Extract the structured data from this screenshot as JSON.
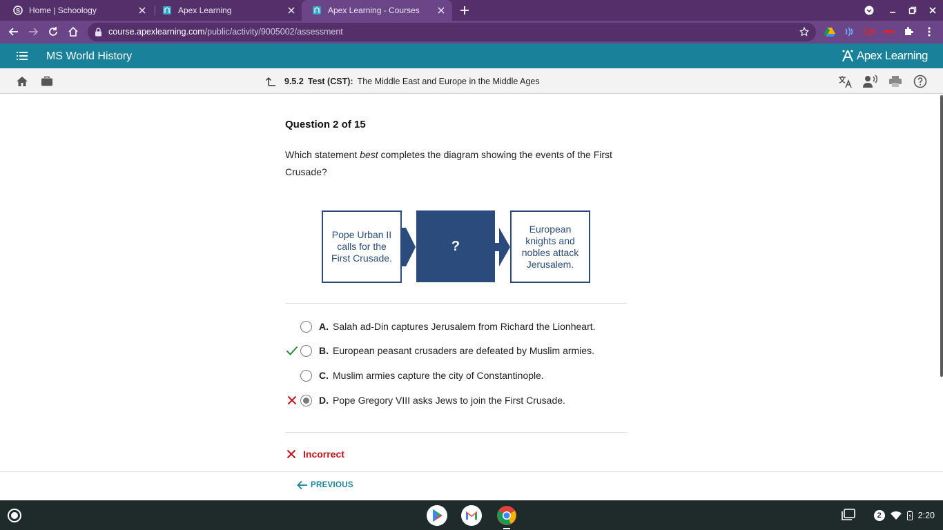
{
  "browser": {
    "tabs": [
      {
        "title": "Home | Schoology",
        "favicon": "schoology-icon"
      },
      {
        "title": "Apex Learning",
        "favicon": "apex-icon"
      },
      {
        "title": "Apex Learning - Courses",
        "favicon": "apex-icon",
        "active": true
      }
    ],
    "url_host": "course.apexlearning.com",
    "url_path": "/public/activity/9005002/assessment"
  },
  "app": {
    "course_title": "MS World History",
    "brand": "Apex Learning",
    "accent_color": "#19819a"
  },
  "activity": {
    "number": "9.5.2",
    "type": "Test (CST):",
    "title": "The Middle East and Europe in the Middle Ages"
  },
  "question": {
    "counter": "Question 2 of 15",
    "text_before": "Which statement ",
    "text_emph": "best",
    "text_after": " completes the diagram showing the events of the First Crusade?"
  },
  "diagram": {
    "box1": "Pope Urban II calls for the First Crusade.",
    "box2": "?",
    "box3": "European knights and nobles attack Jerusalem.",
    "color": "#2a4b7c"
  },
  "options": [
    {
      "letter": "A.",
      "text": "Salah ad-Din captures Jerusalem from Richard the Lionheart.",
      "mark": "",
      "selected": false
    },
    {
      "letter": "B.",
      "text": "European peasant crusaders are defeated by Muslim armies.",
      "mark": "correct",
      "selected": false
    },
    {
      "letter": "C.",
      "text": "Muslim armies capture the city of Constantinople.",
      "mark": "",
      "selected": false
    },
    {
      "letter": "D.",
      "text": "Pope Gregory VIII asks Jews to join the First Crusade.",
      "mark": "incorrect",
      "selected": true
    }
  ],
  "result": {
    "text": "Incorrect",
    "color": "#c0141a"
  },
  "nav": {
    "previous": "PREVIOUS"
  },
  "shelf": {
    "apps": [
      "play-store-icon",
      "gmail-icon",
      "chrome-icon"
    ],
    "notification_count": "2",
    "time": "2:20"
  }
}
